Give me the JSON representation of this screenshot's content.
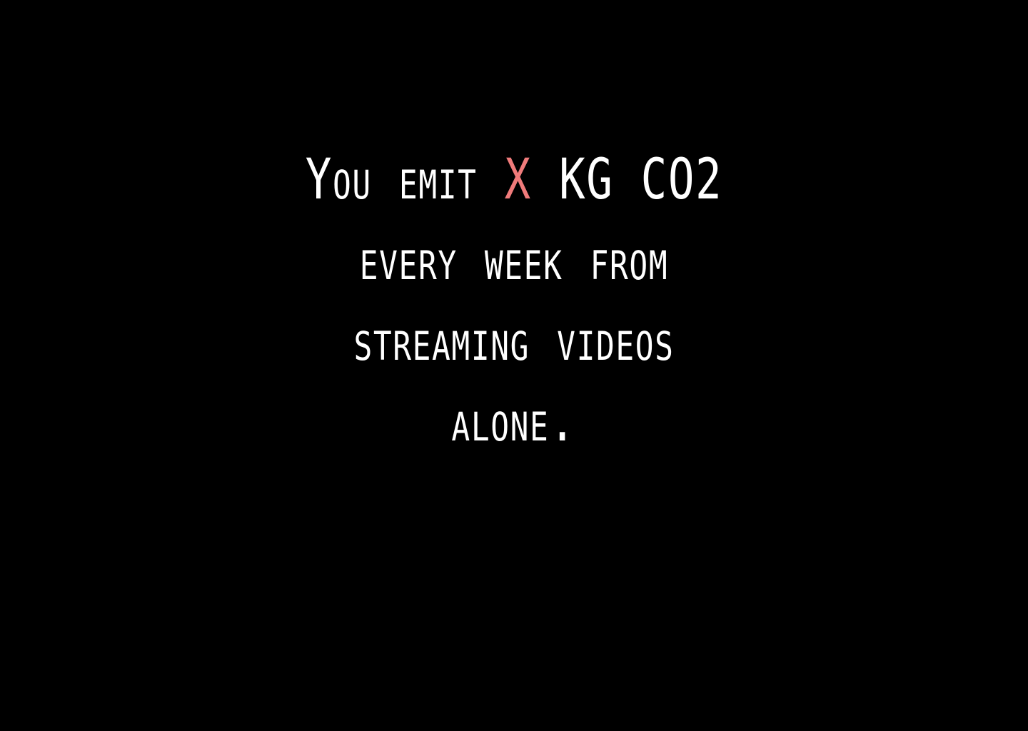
{
  "message": {
    "line1_before": "You emit ",
    "value": "X",
    "line1_after": " KG CO2",
    "line2": "every week from",
    "line3": "streaming videos",
    "line4": "alone."
  },
  "colors": {
    "background": "#000000",
    "text": "#ffffff",
    "highlight": "#f07b7b"
  }
}
